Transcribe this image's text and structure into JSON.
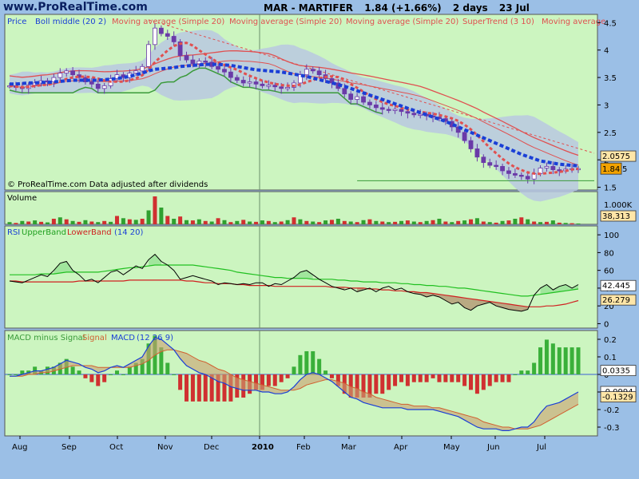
{
  "header": {
    "logo": "www.ProRealTime.com",
    "symbol": "MAR - MARTIFER",
    "price_change": "1.84 (+1.66%)",
    "period": "2 days",
    "date": "23 Jul"
  },
  "colors": {
    "panel_bg": "#ccf5c0",
    "page_bg": "#9bbfe6",
    "candle": "#6a3aa8",
    "boll_band": "#b8c8e0",
    "boll_middle": "#1a3fd6",
    "ma": "#e05050",
    "supertrend": "#3a9a3a",
    "rsi_upper": "#20c020",
    "rsi_lower": "#d02020",
    "macd_hist_pos": "#3ab03a",
    "macd_hist_neg": "#d03030"
  },
  "chart_data": [
    {
      "panel": "price",
      "type": "candlestick",
      "legend": [
        "Price",
        "Boll middle (20 2)",
        "Moving average (Simple 20)",
        "Moving average (Simple 20)",
        "Moving average (Simple 20)",
        "SuperTrend (3 10)",
        "Moving average"
      ],
      "watermark": "© ProRealTime.com  Data adjusted after dividends",
      "y_ticks": [
        1.5,
        2,
        2.5,
        3,
        3.5,
        4,
        4.5
      ],
      "ylim": [
        1.45,
        4.65
      ],
      "last_value": "1.84",
      "value_boxes": [
        "2.0575",
        "1.84",
        "5"
      ],
      "x_labels": [
        "Aug",
        "Sep",
        "Oct",
        "Nov",
        "Dec",
        "2010",
        "Feb",
        "Mar",
        "Apr",
        "May",
        "Jun",
        "Jul"
      ],
      "close": [
        3.35,
        3.32,
        3.3,
        3.36,
        3.4,
        3.44,
        3.42,
        3.5,
        3.58,
        3.62,
        3.55,
        3.5,
        3.42,
        3.38,
        3.3,
        3.35,
        3.48,
        3.55,
        3.5,
        3.58,
        3.62,
        3.7,
        4.1,
        4.4,
        4.3,
        4.25,
        4.15,
        3.9,
        3.82,
        3.75,
        3.8,
        3.78,
        3.7,
        3.65,
        3.6,
        3.5,
        3.45,
        3.4,
        3.42,
        3.38,
        3.35,
        3.36,
        3.33,
        3.3,
        3.32,
        3.4,
        3.55,
        3.65,
        3.62,
        3.55,
        3.48,
        3.4,
        3.3,
        3.2,
        3.1,
        3.15,
        3.05,
        3.0,
        2.95,
        2.92,
        2.9,
        2.92,
        2.88,
        2.85,
        2.82,
        2.83,
        2.8,
        2.78,
        2.75,
        2.7,
        2.6,
        2.5,
        2.35,
        2.2,
        2.05,
        1.95,
        1.9,
        1.88,
        1.8,
        1.75,
        1.72,
        1.7,
        1.65,
        1.75,
        1.85,
        1.88,
        1.82,
        1.8,
        1.83,
        1.84,
        1.84
      ],
      "boll_middle": [
        3.38,
        3.38,
        3.39,
        3.4,
        3.4,
        3.41,
        3.41,
        3.42,
        3.43,
        3.44,
        3.45,
        3.45,
        3.45,
        3.45,
        3.45,
        3.46,
        3.47,
        3.48,
        3.5,
        3.52,
        3.55,
        3.58,
        3.62,
        3.65,
        3.66,
        3.67,
        3.68,
        3.7,
        3.71,
        3.72,
        3.73,
        3.74,
        3.74,
        3.74,
        3.73,
        3.72,
        3.7,
        3.68,
        3.66,
        3.64,
        3.63,
        3.62,
        3.61,
        3.6,
        3.58,
        3.56,
        3.54,
        3.52,
        3.49,
        3.46,
        3.43,
        3.4,
        3.37,
        3.34,
        3.3,
        3.26,
        3.22,
        3.18,
        3.14,
        3.1,
        3.06,
        3.02,
        2.98,
        2.94,
        2.9,
        2.86,
        2.82,
        2.78,
        2.74,
        2.7,
        2.65,
        2.6,
        2.55,
        2.5,
        2.45,
        2.4,
        2.35,
        2.3,
        2.25,
        2.2,
        2.15,
        2.1,
        2.06,
        2.02,
        1.98,
        1.96,
        1.94,
        1.92,
        1.91,
        1.9,
        1.89
      ]
    },
    {
      "panel": "volume",
      "type": "bar",
      "legend": [
        "Volume"
      ],
      "y_ticks": [
        "1.000K"
      ],
      "last_value": "38,313",
      "values": [
        8,
        5,
        12,
        10,
        14,
        9,
        7,
        20,
        25,
        18,
        12,
        9,
        15,
        10,
        8,
        12,
        9,
        30,
        22,
        18,
        16,
        20,
        50,
        100,
        60,
        30,
        20,
        28,
        15,
        14,
        18,
        12,
        10,
        22,
        15,
        8,
        12,
        16,
        10,
        9,
        14,
        12,
        8,
        10,
        15,
        25,
        18,
        12,
        10,
        8,
        14,
        16,
        20,
        12,
        10,
        8,
        15,
        18,
        12,
        10,
        8,
        9,
        12,
        14,
        10,
        8,
        12,
        15,
        20,
        10,
        8,
        12,
        14,
        18,
        22,
        10,
        8,
        6,
        12,
        14,
        20,
        25,
        18,
        10,
        8,
        9,
        14,
        6,
        5,
        4,
        3
      ]
    },
    {
      "panel": "rsi",
      "type": "line",
      "legend": [
        "RSI",
        "UpperBand",
        "LowerBand",
        "(14 20)"
      ],
      "y_ticks": [
        0,
        20,
        40,
        60,
        80,
        100
      ],
      "ylim": [
        -5,
        110
      ],
      "last_value": "42.445",
      "value_boxes": [
        "42.445",
        "26.279"
      ],
      "rsi": [
        48,
        47,
        46,
        49,
        52,
        55,
        53,
        60,
        68,
        70,
        60,
        55,
        48,
        50,
        46,
        52,
        58,
        60,
        55,
        60,
        65,
        62,
        72,
        78,
        70,
        66,
        60,
        50,
        52,
        54,
        52,
        50,
        48,
        44,
        46,
        45,
        44,
        45,
        44,
        46,
        46,
        42,
        45,
        44,
        48,
        52,
        58,
        60,
        55,
        50,
        46,
        42,
        40,
        38,
        40,
        36,
        38,
        40,
        36,
        40,
        42,
        38,
        40,
        36,
        34,
        33,
        30,
        32,
        30,
        26,
        22,
        24,
        18,
        15,
        20,
        22,
        24,
        20,
        18,
        16,
        15,
        14,
        16,
        32,
        40,
        44,
        38,
        42,
        44,
        40,
        44
      ],
      "upper_band": [
        55,
        55,
        55,
        55,
        55,
        56,
        56,
        56,
        57,
        58,
        58,
        58,
        58,
        58,
        58,
        59,
        60,
        61,
        62,
        63,
        63,
        64,
        65,
        66,
        66,
        66,
        66,
        66,
        66,
        66,
        65,
        64,
        63,
        62,
        61,
        60,
        58,
        57,
        56,
        55,
        54,
        53,
        52,
        52,
        51,
        51,
        51,
        51,
        50,
        50,
        50,
        50,
        49,
        49,
        48,
        48,
        47,
        47,
        47,
        46,
        46,
        46,
        45,
        45,
        44,
        44,
        43,
        43,
        42,
        42,
        41,
        40,
        40,
        39,
        38,
        37,
        36,
        35,
        34,
        33,
        32,
        31,
        31,
        32,
        33,
        34,
        35,
        36,
        37,
        38,
        39
      ],
      "lower_band": [
        48,
        48,
        47,
        47,
        47,
        47,
        47,
        47,
        47,
        47,
        47,
        48,
        48,
        48,
        48,
        48,
        48,
        48,
        48,
        49,
        49,
        49,
        49,
        49,
        49,
        49,
        49,
        49,
        48,
        48,
        47,
        46,
        46,
        45,
        45,
        45,
        44,
        44,
        43,
        43,
        43,
        43,
        42,
        42,
        42,
        42,
        42,
        42,
        42,
        42,
        42,
        41,
        41,
        41,
        40,
        40,
        40,
        39,
        39,
        38,
        38,
        37,
        37,
        36,
        36,
        35,
        35,
        34,
        33,
        32,
        31,
        30,
        29,
        28,
        27,
        26,
        25,
        24,
        23,
        22,
        21,
        20,
        19,
        19,
        19,
        20,
        20,
        21,
        22,
        24,
        26
      ]
    },
    {
      "panel": "macd",
      "type": "line",
      "legend": [
        "MACD minus Signal",
        "Signal",
        "MACD",
        "(12 26 9)"
      ],
      "y_ticks": [
        -0.3,
        -0.2,
        -0.1,
        0,
        0.1,
        0.2
      ],
      "ylim": [
        -0.35,
        0.25
      ],
      "last_value": "0.0335",
      "value_boxes": [
        "0.0335",
        "-0.0994",
        "-0.1329"
      ],
      "macd": [
        -0.01,
        -0.01,
        0.0,
        0.01,
        0.02,
        0.02,
        0.03,
        0.04,
        0.06,
        0.08,
        0.07,
        0.06,
        0.04,
        0.03,
        0.01,
        0.02,
        0.04,
        0.05,
        0.04,
        0.06,
        0.08,
        0.1,
        0.16,
        0.21,
        0.2,
        0.17,
        0.14,
        0.09,
        0.05,
        0.03,
        0.01,
        0.0,
        -0.02,
        -0.04,
        -0.05,
        -0.07,
        -0.08,
        -0.09,
        -0.09,
        -0.09,
        -0.1,
        -0.1,
        -0.11,
        -0.11,
        -0.1,
        -0.07,
        -0.03,
        0.0,
        0.01,
        0.0,
        -0.02,
        -0.04,
        -0.07,
        -0.1,
        -0.13,
        -0.14,
        -0.16,
        -0.17,
        -0.18,
        -0.19,
        -0.19,
        -0.19,
        -0.19,
        -0.2,
        -0.2,
        -0.2,
        -0.2,
        -0.2,
        -0.21,
        -0.22,
        -0.23,
        -0.24,
        -0.26,
        -0.28,
        -0.3,
        -0.31,
        -0.31,
        -0.31,
        -0.32,
        -0.32,
        -0.31,
        -0.3,
        -0.3,
        -0.27,
        -0.22,
        -0.18,
        -0.17,
        -0.16,
        -0.14,
        -0.12,
        -0.1
      ],
      "signal": [
        -0.01,
        -0.01,
        -0.01,
        0.0,
        0.0,
        0.01,
        0.01,
        0.02,
        0.03,
        0.04,
        0.05,
        0.05,
        0.05,
        0.05,
        0.04,
        0.04,
        0.04,
        0.04,
        0.04,
        0.04,
        0.05,
        0.06,
        0.08,
        0.11,
        0.13,
        0.14,
        0.14,
        0.13,
        0.12,
        0.1,
        0.08,
        0.07,
        0.05,
        0.03,
        0.02,
        0.0,
        -0.02,
        -0.03,
        -0.04,
        -0.05,
        -0.06,
        -0.07,
        -0.08,
        -0.09,
        -0.09,
        -0.09,
        -0.08,
        -0.06,
        -0.05,
        -0.04,
        -0.03,
        -0.03,
        -0.04,
        -0.05,
        -0.07,
        -0.08,
        -0.1,
        -0.11,
        -0.13,
        -0.14,
        -0.15,
        -0.16,
        -0.17,
        -0.17,
        -0.18,
        -0.18,
        -0.18,
        -0.19,
        -0.19,
        -0.2,
        -0.21,
        -0.22,
        -0.23,
        -0.24,
        -0.25,
        -0.27,
        -0.28,
        -0.29,
        -0.3,
        -0.3,
        -0.31,
        -0.31,
        -0.31,
        -0.3,
        -0.29,
        -0.27,
        -0.25,
        -0.23,
        -0.21,
        -0.19,
        -0.17
      ]
    }
  ]
}
